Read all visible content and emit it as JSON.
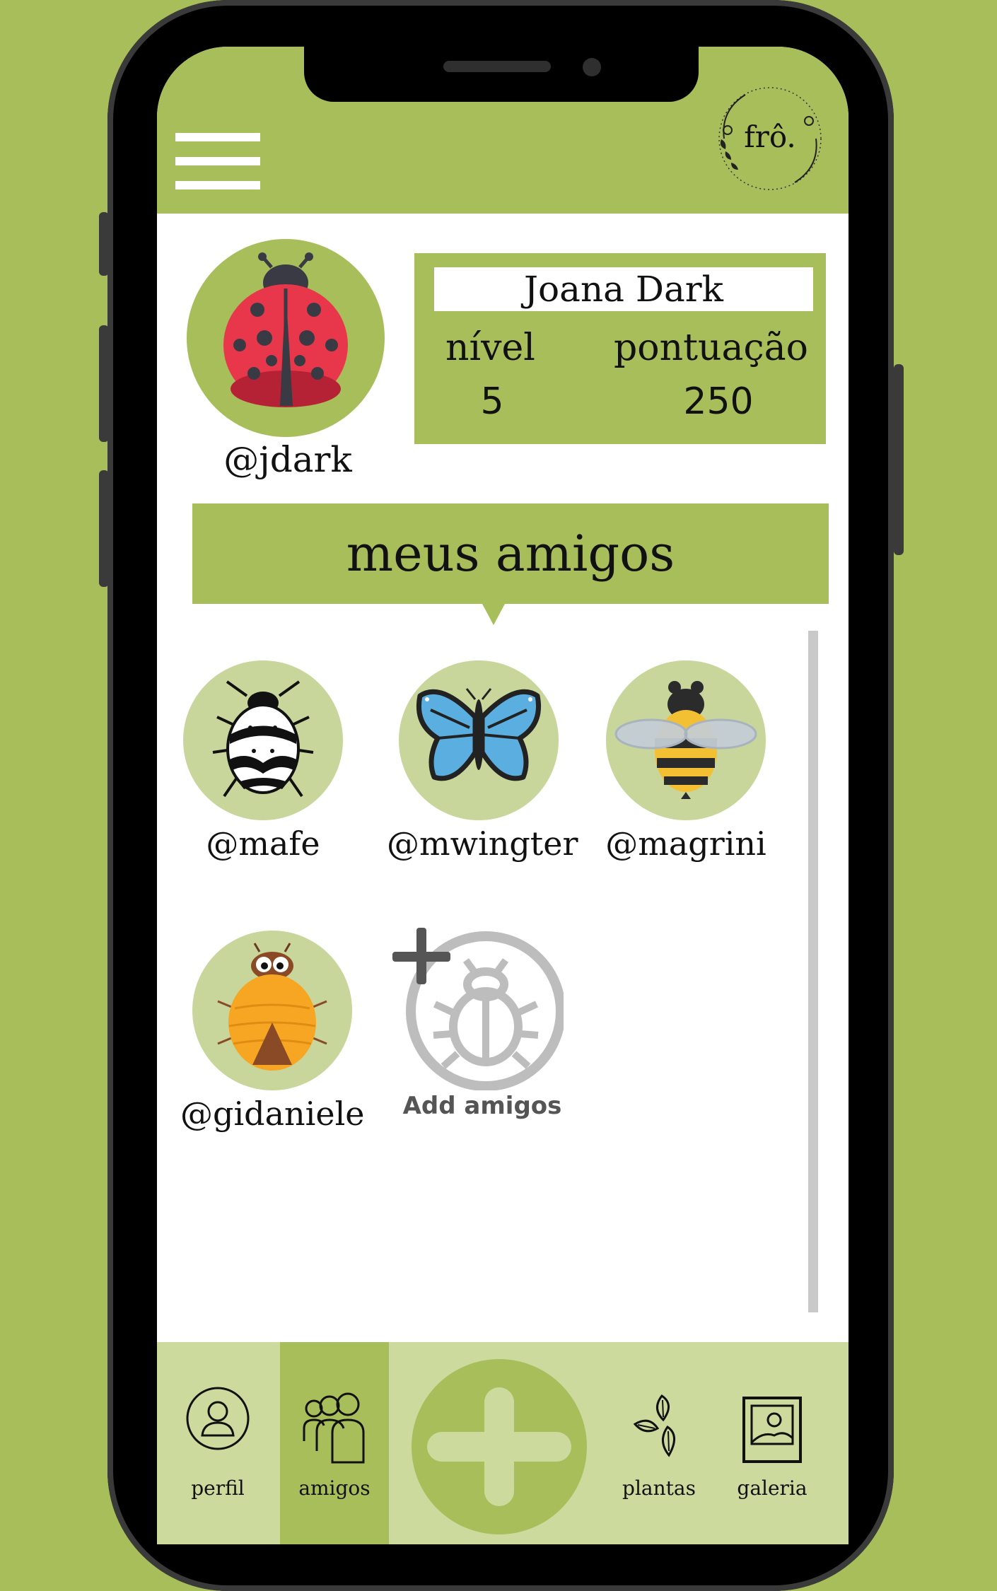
{
  "app": {
    "logo_text": "frô."
  },
  "profile": {
    "name": "Joana Dark",
    "handle": "@jdark",
    "level_label": "nível",
    "level_value": "5",
    "score_label": "pontuação",
    "score_value": "250"
  },
  "friends_section": {
    "title": "meus amigos",
    "friends": [
      {
        "handle": "@mafe",
        "icon": "beetle-icon"
      },
      {
        "handle": "@mwingter",
        "icon": "butterfly-icon"
      },
      {
        "handle": "@magrini",
        "icon": "bee-icon"
      },
      {
        "handle": "@gidaniele",
        "icon": "yellow-bug-icon"
      }
    ],
    "add_label": "Add amigos"
  },
  "bottom_nav": {
    "items": [
      {
        "label": "perfil",
        "icon": "user-icon",
        "active": false
      },
      {
        "label": "amigos",
        "icon": "group-icon",
        "active": true
      },
      {
        "label": "plantas",
        "icon": "leaves-icon",
        "active": false
      },
      {
        "label": "galeria",
        "icon": "gallery-icon",
        "active": false
      }
    ]
  },
  "colors": {
    "brand_green": "#a8be5a",
    "light_green": "#c8d69b",
    "nav_bg": "#cdda9e"
  }
}
